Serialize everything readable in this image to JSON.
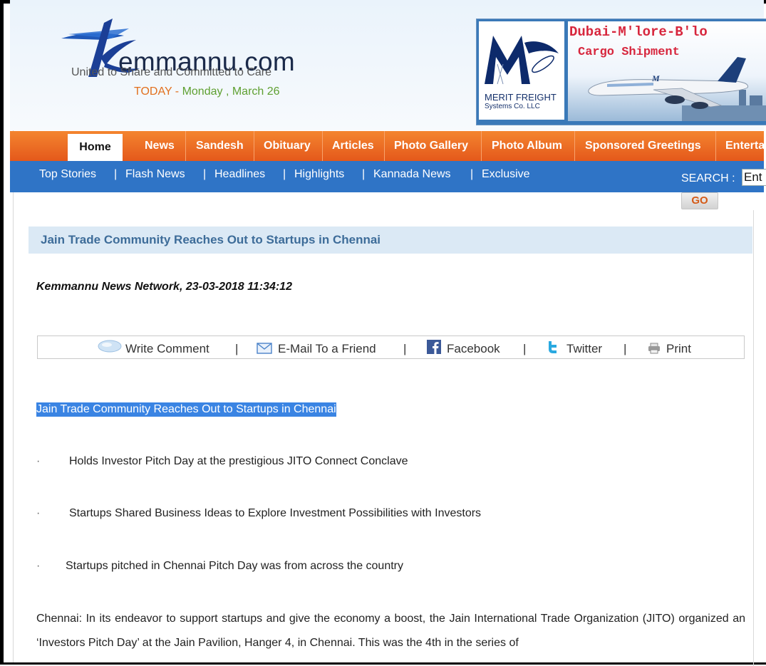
{
  "header": {
    "logo_text": "emmannu.com",
    "tagline": "United to Share and Committed to Care",
    "today_label": "TODAY - ",
    "today_date": "Monday , March 26"
  },
  "banner": {
    "title": "Dubai-M'lore-B'lo",
    "subtitle": "Cargo Shipment",
    "company_line1": "MERIT FREIGHT",
    "company_line2": "Systems Co. LLC"
  },
  "main_nav": [
    {
      "label": "Home",
      "active": true
    },
    {
      "label": "News"
    },
    {
      "label": "Sandesh"
    },
    {
      "label": "Obituary"
    },
    {
      "label": "Articles"
    },
    {
      "label": "Photo Gallery"
    },
    {
      "label": "Photo Album"
    },
    {
      "label": "Sponsored Greetings"
    },
    {
      "label": "Enterta"
    }
  ],
  "sub_nav": [
    {
      "label": "Top Stories"
    },
    {
      "label": "Flash News"
    },
    {
      "label": "Headlines"
    },
    {
      "label": "Highlights"
    },
    {
      "label": "Kannada News"
    },
    {
      "label": "Exclusive"
    }
  ],
  "search": {
    "label": "SEARCH :",
    "value": "Ent",
    "button": "GO"
  },
  "article": {
    "header_title": "Jain Trade Community Reaches Out to Startups in Chennai",
    "byline": "Kemmannu News Network, 23-03-2018 11:34:12",
    "actions": {
      "comment": "Write Comment",
      "email": "E-Mail To a Friend",
      "facebook": "Facebook",
      "twitter": "Twitter",
      "print": "Print",
      "separator": "|"
    },
    "highlight_title": "Jain Trade Community Reaches Out to Startups in Chennai",
    "bullet_char": "·",
    "bullets": [
      "Holds Investor Pitch Day at the prestigious JITO Connect Conclave",
      "Startups Shared Business Ideas to Explore Investment Possibilities with Investors",
      "Startups pitched in Chennai Pitch Day was from across the country"
    ],
    "paragraph": "Chennai: In its endeavor to support startups and give the economy a boost, the Jain International Trade Organization (JITO) organized an ‘Investors Pitch Day’ at the Jain Pavilion, Hanger 4, in Chennai. This was the 4th in the series of"
  },
  "colors": {
    "nav_orange": "#e4581b",
    "subnav_blue": "#2f74c6",
    "title_blue": "#3d6c99",
    "highlight_blue": "#3a84e3"
  }
}
